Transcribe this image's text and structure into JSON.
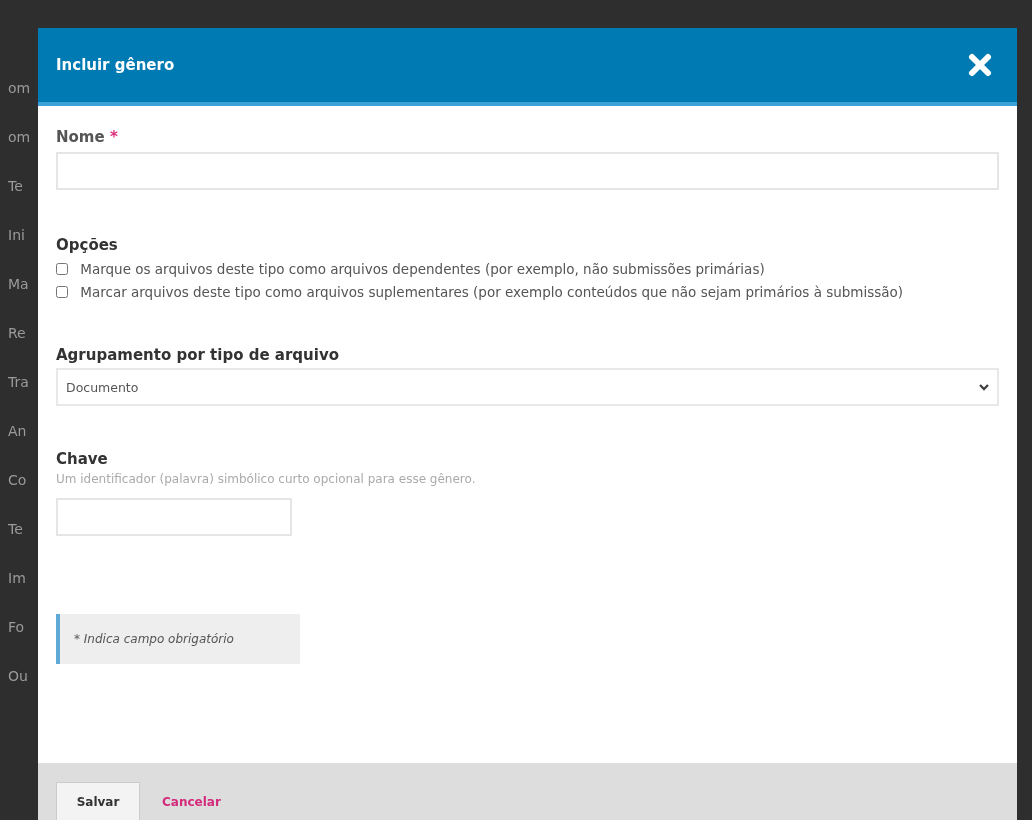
{
  "background_sidebar": [
    "om",
    "om",
    "Te",
    "Ini",
    "Ma",
    "Re",
    "Tra",
    "An",
    "Co",
    "Te",
    "Im",
    "Fo",
    "Ou"
  ],
  "dialog": {
    "title": "Incluir gênero",
    "name_field": {
      "label": "Nome",
      "required_mark": "*"
    },
    "options": {
      "heading": "Opções",
      "items": [
        {
          "label": "Marque os arquivos deste tipo como arquivos dependentes (por exemplo, não submissões primárias)",
          "checked": false
        },
        {
          "label": "Marcar arquivos deste tipo como arquivos suplementares (por exemplo conteúdos que não sejam primários à submissão)",
          "checked": false
        }
      ]
    },
    "grouping": {
      "label": "Agrupamento por tipo de arquivo",
      "value": "Documento"
    },
    "key_field": {
      "label": "Chave",
      "description": "Um identificador (palavra) simbólico curto opcional para esse gênero."
    },
    "required_note": "* Indica campo obrigatório",
    "buttons": {
      "save": "Salvar",
      "cancel": "Cancelar"
    }
  }
}
